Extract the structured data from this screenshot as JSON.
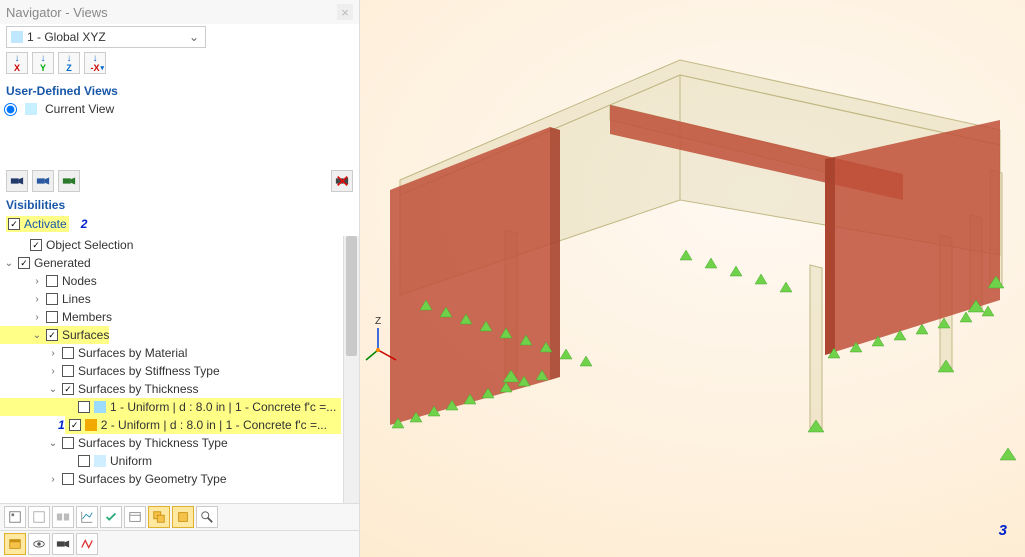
{
  "panel": {
    "title": "Navigator - Views",
    "combo_label": "1 - Global XYZ",
    "axes": [
      "X",
      "Y",
      "Z",
      "-X"
    ],
    "ud_views_title": "User-Defined Views",
    "current_view": "Current View",
    "visibilities_title": "Visibilities",
    "activate": "Activate"
  },
  "tree": {
    "object_selection": "Object Selection",
    "generated": "Generated",
    "nodes": "Nodes",
    "lines": "Lines",
    "members": "Members",
    "surfaces": "Surfaces",
    "surf_material": "Surfaces by Material",
    "surf_stiffness": "Surfaces by Stiffness Type",
    "surf_thickness": "Surfaces by Thickness",
    "thk1": "1 - Uniform | d : 8.0 in | 1 - Concrete f'c =...",
    "thk2": "2 - Uniform | d : 8.0 in | 1 - Concrete f'c =...",
    "surf_thickness_type": "Surfaces by Thickness Type",
    "uniform": "Uniform",
    "surf_geom": "Surfaces by Geometry Type"
  },
  "colors": {
    "thk1": "#9edcff",
    "thk2": "#f2a900",
    "wall": "#c0503a",
    "wall_dark": "#a8422e",
    "beam": "#d7cda0",
    "support": "#6fd24a"
  },
  "viewport": {
    "axis_label": "Z",
    "annot3": "3"
  },
  "annotations": {
    "a1": "1",
    "a2": "2"
  }
}
